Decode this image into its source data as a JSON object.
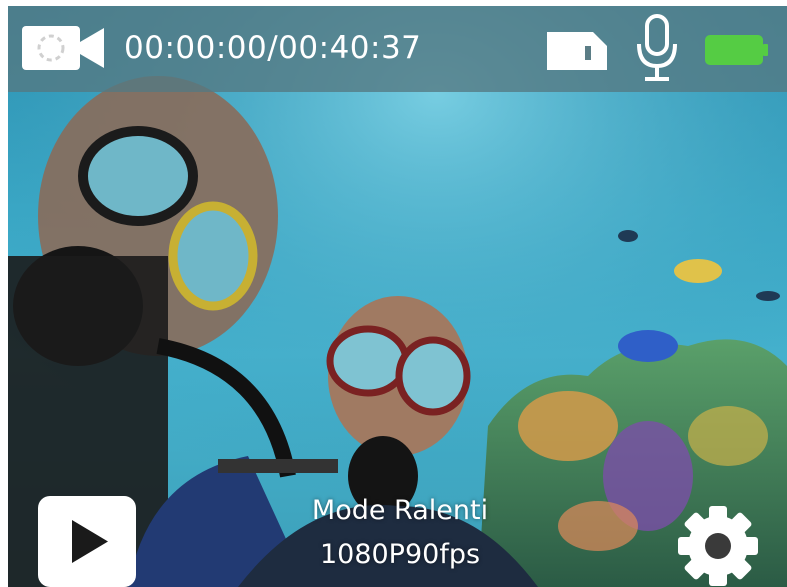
{
  "status_bar": {
    "timecode": "00:00:00/00:40:37",
    "mode_icon": "video-camera-icon",
    "storage_icon": "sd-card-icon",
    "audio_icon": "microphone-icon",
    "battery_icon": "battery-icon",
    "battery_level": 1.0,
    "battery_color": "#55cc44"
  },
  "bottom_bar": {
    "playback_icon": "play-icon",
    "mode_label": "Mode Ralenti",
    "mode_value": "1080P90fps",
    "settings_icon": "gear-icon"
  },
  "viewfinder": {
    "scene": "underwater-live-preview"
  }
}
